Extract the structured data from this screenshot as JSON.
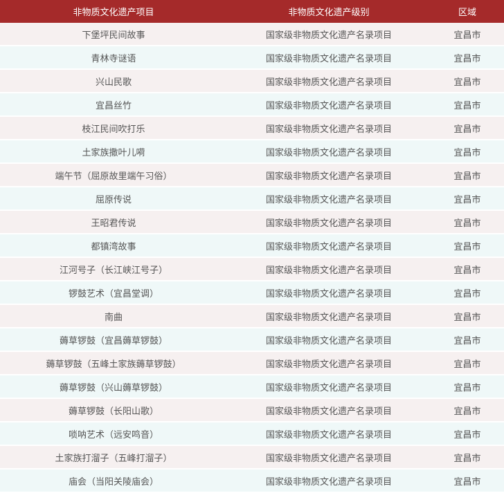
{
  "colors": {
    "header_bg": "#a52a2a",
    "header_text": "#ffffff",
    "row_odd_bg": "#f6f0f0",
    "row_even_bg": "#eff8f8",
    "cell_text": "#555555"
  },
  "table": {
    "headers": [
      "非物质文化遗产项目",
      "非物质文化遗产级别",
      "区域"
    ],
    "rows": [
      [
        "下堡坪民间故事",
        "国家级非物质文化遗产名录项目",
        "宜昌市"
      ],
      [
        "青林寺谜语",
        "国家级非物质文化遗产名录项目",
        "宜昌市"
      ],
      [
        "兴山民歌",
        "国家级非物质文化遗产名录项目",
        "宜昌市"
      ],
      [
        "宜昌丝竹",
        "国家级非物质文化遗产名录项目",
        "宜昌市"
      ],
      [
        "枝江民间吹打乐",
        "国家级非物质文化遗产名录项目",
        "宜昌市"
      ],
      [
        "土家族撒叶儿嗬",
        "国家级非物质文化遗产名录项目",
        "宜昌市"
      ],
      [
        "端午节（屈原故里端午习俗）",
        "国家级非物质文化遗产名录项目",
        "宜昌市"
      ],
      [
        "屈原传说",
        "国家级非物质文化遗产名录项目",
        "宜昌市"
      ],
      [
        "王昭君传说",
        "国家级非物质文化遗产名录项目",
        "宜昌市"
      ],
      [
        "都镇湾故事",
        "国家级非物质文化遗产名录项目",
        "宜昌市"
      ],
      [
        "江河号子（长江峡江号子）",
        "国家级非物质文化遗产名录项目",
        "宜昌市"
      ],
      [
        "锣鼓艺术（宜昌堂调）",
        "国家级非物质文化遗产名录项目",
        "宜昌市"
      ],
      [
        "南曲",
        "国家级非物质文化遗产名录项目",
        "宜昌市"
      ],
      [
        "薅草锣鼓（宜昌薅草锣鼓）",
        "国家级非物质文化遗产名录项目",
        "宜昌市"
      ],
      [
        "薅草锣鼓（五峰土家族薅草锣鼓）",
        "国家级非物质文化遗产名录项目",
        "宜昌市"
      ],
      [
        "薅草锣鼓（兴山薅草锣鼓）",
        "国家级非物质文化遗产名录项目",
        "宜昌市"
      ],
      [
        "薅草锣鼓（长阳山歌）",
        "国家级非物质文化遗产名录项目",
        "宜昌市"
      ],
      [
        "唢呐艺术（远安鸣音）",
        "国家级非物质文化遗产名录项目",
        "宜昌市"
      ],
      [
        "土家族打溜子（五峰打溜子）",
        "国家级非物质文化遗产名录项目",
        "宜昌市"
      ],
      [
        "庙会（当阳关陵庙会）",
        "国家级非物质文化遗产名录项目",
        "宜昌市"
      ]
    ]
  }
}
